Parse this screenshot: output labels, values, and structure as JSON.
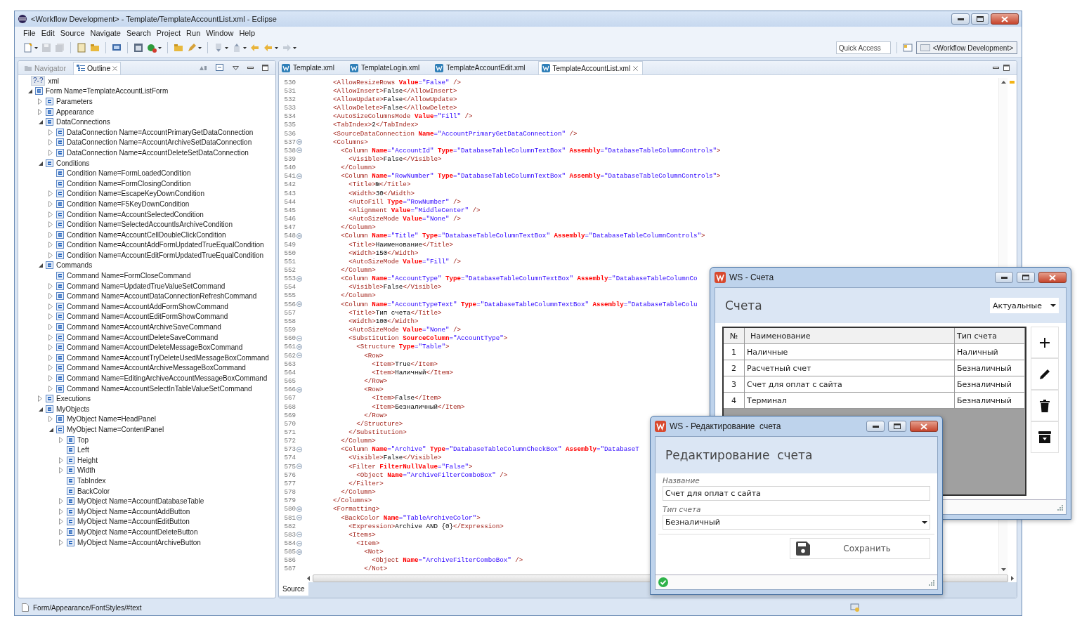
{
  "window": {
    "title": "<Workflow Development> - Template/TemplateAccountList.xml - Eclipse"
  },
  "menu": [
    "File",
    "Edit",
    "Source",
    "Navigate",
    "Search",
    "Project",
    "Run",
    "Window",
    "Help"
  ],
  "toolbar": {
    "quick_access": {
      "placeholder": "Quick Access"
    },
    "perspective": "<Workflow Development>"
  },
  "side_tabs": [
    {
      "label": "Navigator",
      "selected": false
    },
    {
      "label": "Outline",
      "selected": true
    }
  ],
  "outline": {
    "tree": [
      {
        "kind": "prolog",
        "badge": "?-?",
        "label": "xml"
      },
      {
        "kind": "element",
        "label": "Form Name=TemplateAccountListForm",
        "expanded": true,
        "children": [
          {
            "kind": "element",
            "label": "Parameters",
            "expanded": false
          },
          {
            "kind": "element",
            "label": "Appearance",
            "expanded": false
          },
          {
            "kind": "element",
            "label": "DataConnections",
            "expanded": true,
            "children": [
              {
                "kind": "element",
                "label": "DataConnection Name=AccountPrimaryGetDataConnection",
                "expanded": false
              },
              {
                "kind": "element",
                "label": "DataConnection Name=AccountArchiveSetDataConnection",
                "expanded": false
              },
              {
                "kind": "element",
                "label": "DataConnection Name=AccountDeleteSetDataConnection",
                "expanded": false
              }
            ]
          },
          {
            "kind": "element",
            "label": "Conditions",
            "expanded": true,
            "children": [
              {
                "kind": "element",
                "label": "Condition Name=FormLoadedCondition"
              },
              {
                "kind": "element",
                "label": "Condition Name=FormClosingCondition"
              },
              {
                "kind": "element",
                "label": "Condition Name=EscapeKeyDownCondition",
                "expanded": false
              },
              {
                "kind": "element",
                "label": "Condition Name=F5KeyDownCondition",
                "expanded": false
              },
              {
                "kind": "element",
                "label": "Condition Name=AccountSelectedCondition",
                "expanded": false
              },
              {
                "kind": "element",
                "label": "Condition Name=SelectedAccountIsArchiveCondition",
                "expanded": false
              },
              {
                "kind": "element",
                "label": "Condition Name=AccountCellDoubleClickCondition",
                "expanded": false
              },
              {
                "kind": "element",
                "label": "Condition Name=AccountAddFormUpdatedTrueEqualCondition",
                "expanded": false
              },
              {
                "kind": "element",
                "label": "Condition Name=AccountEditFormUpdatedTrueEqualCondition",
                "expanded": false
              }
            ]
          },
          {
            "kind": "element",
            "label": "Commands",
            "expanded": true,
            "children": [
              {
                "kind": "element",
                "label": "Command Name=FormCloseCommand"
              },
              {
                "kind": "element",
                "label": "Command Name=UpdatedTrueValueSetCommand",
                "expanded": false
              },
              {
                "kind": "element",
                "label": "Command Name=AccountDataConnectionRefreshCommand",
                "expanded": false
              },
              {
                "kind": "element",
                "label": "Command Name=AccountAddFormShowCommand",
                "expanded": false
              },
              {
                "kind": "element",
                "label": "Command Name=AccountEditFormShowCommand",
                "expanded": false
              },
              {
                "kind": "element",
                "label": "Command Name=AccountArchiveSaveCommand",
                "expanded": false
              },
              {
                "kind": "element",
                "label": "Command Name=AccountDeleteSaveCommand",
                "expanded": false
              },
              {
                "kind": "element",
                "label": "Command Name=AccountDeleteMessageBoxCommand",
                "expanded": false
              },
              {
                "kind": "element",
                "label": "Command Name=AccountTryDeleteUsedMessageBoxCommand",
                "expanded": false
              },
              {
                "kind": "element",
                "label": "Command Name=AccountArchiveMessageBoxCommand",
                "expanded": false
              },
              {
                "kind": "element",
                "label": "Command Name=EditingArchiveAccountMessageBoxCommand",
                "expanded": false
              },
              {
                "kind": "element",
                "label": "Command Name=AccountSelectInTableValueSetCommand",
                "expanded": false
              }
            ]
          },
          {
            "kind": "element",
            "label": "Executions",
            "expanded": false
          },
          {
            "kind": "element",
            "label": "MyObjects",
            "expanded": true,
            "children": [
              {
                "kind": "element",
                "label": "MyObject Name=HeadPanel",
                "expanded": false
              },
              {
                "kind": "element",
                "label": "MyObject Name=ContentPanel",
                "expanded": true,
                "children": [
                  {
                    "kind": "element",
                    "label": "Top",
                    "expanded": false
                  },
                  {
                    "kind": "element",
                    "label": "Left"
                  },
                  {
                    "kind": "element",
                    "label": "Height",
                    "expanded": false
                  },
                  {
                    "kind": "element",
                    "label": "Width",
                    "expanded": false
                  },
                  {
                    "kind": "element",
                    "label": "TabIndex"
                  },
                  {
                    "kind": "element",
                    "label": "BackColor"
                  },
                  {
                    "kind": "element",
                    "label": "MyObject Name=AccountDatabaseTable",
                    "expanded": false
                  },
                  {
                    "kind": "element",
                    "label": "MyObject Name=AccountAddButton",
                    "expanded": false
                  },
                  {
                    "kind": "element",
                    "label": "MyObject Name=AccountEditButton",
                    "expanded": false
                  },
                  {
                    "kind": "element",
                    "label": "MyObject Name=AccountDeleteButton",
                    "expanded": false
                  },
                  {
                    "kind": "element",
                    "label": "MyObject Name=AccountArchiveButton",
                    "expanded": false
                  }
                ]
              }
            ]
          }
        ]
      }
    ]
  },
  "editor": {
    "tabs": [
      {
        "label": "Template.xml",
        "selected": false
      },
      {
        "label": "TemplateLogin.xml",
        "selected": false
      },
      {
        "label": "TemplateAccountEdit.xml",
        "selected": false
      },
      {
        "label": "TemplateAccountList.xml",
        "selected": true
      }
    ],
    "lines": [
      {
        "number": "530",
        "foldable": false,
        "tokens": [
          {
            "kind": "tag",
            "text": "        <AllowResizeRows"
          },
          {
            "kind": "attr",
            "text": " Value"
          },
          {
            "kind": "value",
            "text": "=\"False\""
          },
          {
            "kind": "tag",
            "text": " />"
          }
        ]
      },
      {
        "number": "531",
        "foldable": false,
        "tokens": [
          {
            "kind": "tag",
            "text": "        <AllowInsert>"
          },
          {
            "kind": "text",
            "text": "False"
          },
          {
            "kind": "tag",
            "text": "</AllowInsert>"
          }
        ]
      },
      {
        "number": "532",
        "foldable": false,
        "tokens": [
          {
            "kind": "tag",
            "text": "        <AllowUpdate>"
          },
          {
            "kind": "text",
            "text": "False"
          },
          {
            "kind": "tag",
            "text": "</AllowUpdate>"
          }
        ]
      },
      {
        "number": "533",
        "foldable": false,
        "tokens": [
          {
            "kind": "tag",
            "text": "        <AllowDelete>"
          },
          {
            "kind": "text",
            "text": "False"
          },
          {
            "kind": "tag",
            "text": "</AllowDelete>"
          }
        ]
      },
      {
        "number": "534",
        "foldable": false,
        "tokens": [
          {
            "kind": "tag",
            "text": "        <AutoSizeColumnsMode"
          },
          {
            "kind": "attr",
            "text": " Value"
          },
          {
            "kind": "value",
            "text": "=\"Fill\""
          },
          {
            "kind": "tag",
            "text": " />"
          }
        ]
      },
      {
        "number": "535",
        "foldable": false,
        "tokens": [
          {
            "kind": "tag",
            "text": "        <TabIndex>"
          },
          {
            "kind": "text",
            "text": "2"
          },
          {
            "kind": "tag",
            "text": "</TabIndex>"
          }
        ]
      },
      {
        "number": "536",
        "foldable": false,
        "tokens": [
          {
            "kind": "tag",
            "text": "        <SourceDataConnection"
          },
          {
            "kind": "attr",
            "text": " Name"
          },
          {
            "kind": "value",
            "text": "=\"AccountPrimaryGetDataConnection\""
          },
          {
            "kind": "tag",
            "text": " />"
          }
        ]
      },
      {
        "number": "537",
        "foldable": true,
        "tokens": [
          {
            "kind": "tag",
            "text": "        <Columns>"
          }
        ]
      },
      {
        "number": "538",
        "foldable": true,
        "tokens": [
          {
            "kind": "tag",
            "text": "          <Column"
          },
          {
            "kind": "attr",
            "text": " Name"
          },
          {
            "kind": "value",
            "text": "=\"AccountId\""
          },
          {
            "kind": "attr",
            "text": " Type"
          },
          {
            "kind": "value",
            "text": "=\"DatabaseTableColumnTextBox\""
          },
          {
            "kind": "attr",
            "text": " Assembly"
          },
          {
            "kind": "value",
            "text": "=\"DatabaseTableColumnControls\""
          },
          {
            "kind": "tag",
            "text": ">"
          }
        ]
      },
      {
        "number": "539",
        "foldable": false,
        "tokens": [
          {
            "kind": "tag",
            "text": "            <Visible>"
          },
          {
            "kind": "text",
            "text": "False"
          },
          {
            "kind": "tag",
            "text": "</Visible>"
          }
        ]
      },
      {
        "number": "540",
        "foldable": false,
        "tokens": [
          {
            "kind": "tag",
            "text": "          </Column>"
          }
        ]
      },
      {
        "number": "541",
        "foldable": true,
        "tokens": [
          {
            "kind": "tag",
            "text": "          <Column"
          },
          {
            "kind": "attr",
            "text": " Name"
          },
          {
            "kind": "value",
            "text": "=\"RowNumber\""
          },
          {
            "kind": "attr",
            "text": " Type"
          },
          {
            "kind": "value",
            "text": "=\"DatabaseTableColumnTextBox\""
          },
          {
            "kind": "attr",
            "text": " Assembly"
          },
          {
            "kind": "value",
            "text": "=\"DatabaseTableColumnControls\""
          },
          {
            "kind": "tag",
            "text": ">"
          }
        ]
      },
      {
        "number": "542",
        "foldable": false,
        "tokens": [
          {
            "kind": "tag",
            "text": "            <Title>"
          },
          {
            "kind": "text",
            "text": "№"
          },
          {
            "kind": "tag",
            "text": "</Title>"
          }
        ]
      },
      {
        "number": "543",
        "foldable": false,
        "tokens": [
          {
            "kind": "tag",
            "text": "            <Width>"
          },
          {
            "kind": "text",
            "text": "30"
          },
          {
            "kind": "tag",
            "text": "</Width>"
          }
        ]
      },
      {
        "number": "544",
        "foldable": false,
        "tokens": [
          {
            "kind": "tag",
            "text": "            <AutoFill"
          },
          {
            "kind": "attr",
            "text": " Type"
          },
          {
            "kind": "value",
            "text": "=\"RowNumber\""
          },
          {
            "kind": "tag",
            "text": " />"
          }
        ]
      },
      {
        "number": "545",
        "foldable": false,
        "tokens": [
          {
            "kind": "tag",
            "text": "            <Alignment"
          },
          {
            "kind": "attr",
            "text": " Value"
          },
          {
            "kind": "value",
            "text": "=\"MiddleCenter\""
          },
          {
            "kind": "tag",
            "text": " />"
          }
        ]
      },
      {
        "number": "546",
        "foldable": false,
        "tokens": [
          {
            "kind": "tag",
            "text": "            <AutoSizeMode"
          },
          {
            "kind": "attr",
            "text": " Value"
          },
          {
            "kind": "value",
            "text": "=\"None\""
          },
          {
            "kind": "tag",
            "text": " />"
          }
        ]
      },
      {
        "number": "547",
        "foldable": false,
        "tokens": [
          {
            "kind": "tag",
            "text": "          </Column>"
          }
        ]
      },
      {
        "number": "548",
        "foldable": true,
        "tokens": [
          {
            "kind": "tag",
            "text": "          <Column"
          },
          {
            "kind": "attr",
            "text": " Name"
          },
          {
            "kind": "value",
            "text": "=\"Title\""
          },
          {
            "kind": "attr",
            "text": " Type"
          },
          {
            "kind": "value",
            "text": "=\"DatabaseTableColumnTextBox\""
          },
          {
            "kind": "attr",
            "text": " Assembly"
          },
          {
            "kind": "value",
            "text": "=\"DatabaseTableColumnControls\""
          },
          {
            "kind": "tag",
            "text": ">"
          }
        ]
      },
      {
        "number": "549",
        "foldable": false,
        "tokens": [
          {
            "kind": "tag",
            "text": "            <Title>"
          },
          {
            "kind": "text",
            "text": "Наименование"
          },
          {
            "kind": "tag",
            "text": "</Title>"
          }
        ]
      },
      {
        "number": "550",
        "foldable": false,
        "tokens": [
          {
            "kind": "tag",
            "text": "            <Width>"
          },
          {
            "kind": "text",
            "text": "150"
          },
          {
            "kind": "tag",
            "text": "</Width>"
          }
        ]
      },
      {
        "number": "551",
        "foldable": false,
        "tokens": [
          {
            "kind": "tag",
            "text": "            <AutoSizeMode"
          },
          {
            "kind": "attr",
            "text": " Value"
          },
          {
            "kind": "value",
            "text": "=\"Fill\""
          },
          {
            "kind": "tag",
            "text": " />"
          }
        ]
      },
      {
        "number": "552",
        "foldable": false,
        "tokens": [
          {
            "kind": "tag",
            "text": "          </Column>"
          }
        ]
      },
      {
        "number": "553",
        "foldable": true,
        "tokens": [
          {
            "kind": "tag",
            "text": "          <Column"
          },
          {
            "kind": "attr",
            "text": " Name"
          },
          {
            "kind": "value",
            "text": "=\"AccountType\""
          },
          {
            "kind": "attr",
            "text": " Type"
          },
          {
            "kind": "value",
            "text": "=\"DatabaseTableColumnTextBox\""
          },
          {
            "kind": "attr",
            "text": " Assembly"
          },
          {
            "kind": "value",
            "text": "=\"DatabaseTableColumnCo"
          }
        ]
      },
      {
        "number": "554",
        "foldable": false,
        "tokens": [
          {
            "kind": "tag",
            "text": "            <Visible>"
          },
          {
            "kind": "text",
            "text": "False"
          },
          {
            "kind": "tag",
            "text": "</Visible>"
          }
        ]
      },
      {
        "number": "555",
        "foldable": false,
        "tokens": [
          {
            "kind": "tag",
            "text": "          </Column>"
          }
        ]
      },
      {
        "number": "556",
        "foldable": true,
        "tokens": [
          {
            "kind": "tag",
            "text": "          <Column"
          },
          {
            "kind": "attr",
            "text": " Name"
          },
          {
            "kind": "value",
            "text": "=\"AccountTypeText\""
          },
          {
            "kind": "attr",
            "text": " Type"
          },
          {
            "kind": "value",
            "text": "=\"DatabaseTableColumnTextBox\""
          },
          {
            "kind": "attr",
            "text": " Assembly"
          },
          {
            "kind": "value",
            "text": "=\"DatabaseTableColu"
          }
        ]
      },
      {
        "number": "557",
        "foldable": false,
        "tokens": [
          {
            "kind": "tag",
            "text": "            <Title>"
          },
          {
            "kind": "text",
            "text": "Тип счета"
          },
          {
            "kind": "tag",
            "text": "</Title>"
          }
        ]
      },
      {
        "number": "558",
        "foldable": false,
        "tokens": [
          {
            "kind": "tag",
            "text": "            <Width>"
          },
          {
            "kind": "text",
            "text": "100"
          },
          {
            "kind": "tag",
            "text": "</Width>"
          }
        ]
      },
      {
        "number": "559",
        "foldable": false,
        "tokens": [
          {
            "kind": "tag",
            "text": "            <AutoSizeMode"
          },
          {
            "kind": "attr",
            "text": " Value"
          },
          {
            "kind": "value",
            "text": "=\"None\""
          },
          {
            "kind": "tag",
            "text": " />"
          }
        ]
      },
      {
        "number": "560",
        "foldable": true,
        "tokens": [
          {
            "kind": "tag",
            "text": "            <Substitution"
          },
          {
            "kind": "attr",
            "text": " SourceColumn"
          },
          {
            "kind": "value",
            "text": "=\"AccountType\""
          },
          {
            "kind": "tag",
            "text": ">"
          }
        ]
      },
      {
        "number": "561",
        "foldable": true,
        "tokens": [
          {
            "kind": "tag",
            "text": "              <Structure"
          },
          {
            "kind": "attr",
            "text": " Type"
          },
          {
            "kind": "value",
            "text": "=\"Table\""
          },
          {
            "kind": "tag",
            "text": ">"
          }
        ]
      },
      {
        "number": "562",
        "foldable": true,
        "tokens": [
          {
            "kind": "tag",
            "text": "                <Row>"
          }
        ]
      },
      {
        "number": "563",
        "foldable": false,
        "tokens": [
          {
            "kind": "tag",
            "text": "                  <Item>"
          },
          {
            "kind": "text",
            "text": "True"
          },
          {
            "kind": "tag",
            "text": "</Item>"
          }
        ]
      },
      {
        "number": "564",
        "foldable": false,
        "tokens": [
          {
            "kind": "tag",
            "text": "                  <Item>"
          },
          {
            "kind": "text",
            "text": "Наличный"
          },
          {
            "kind": "tag",
            "text": "</Item>"
          }
        ]
      },
      {
        "number": "565",
        "foldable": false,
        "tokens": [
          {
            "kind": "tag",
            "text": "                </Row>"
          }
        ]
      },
      {
        "number": "566",
        "foldable": true,
        "tokens": [
          {
            "kind": "tag",
            "text": "                <Row>"
          }
        ]
      },
      {
        "number": "567",
        "foldable": false,
        "tokens": [
          {
            "kind": "tag",
            "text": "                  <Item>"
          },
          {
            "kind": "text",
            "text": "False"
          },
          {
            "kind": "tag",
            "text": "</Item>"
          }
        ]
      },
      {
        "number": "568",
        "foldable": false,
        "tokens": [
          {
            "kind": "tag",
            "text": "                  <Item>"
          },
          {
            "kind": "text",
            "text": "Безналичный"
          },
          {
            "kind": "tag",
            "text": "</Item>"
          }
        ]
      },
      {
        "number": "569",
        "foldable": false,
        "tokens": [
          {
            "kind": "tag",
            "text": "                </Row>"
          }
        ]
      },
      {
        "number": "570",
        "foldable": false,
        "tokens": [
          {
            "kind": "tag",
            "text": "              </Structure>"
          }
        ]
      },
      {
        "number": "571",
        "foldable": false,
        "tokens": [
          {
            "kind": "tag",
            "text": "            </Substitution>"
          }
        ]
      },
      {
        "number": "572",
        "foldable": false,
        "tokens": [
          {
            "kind": "tag",
            "text": "          </Column>"
          }
        ]
      },
      {
        "number": "573",
        "foldable": true,
        "tokens": [
          {
            "kind": "tag",
            "text": "          <Column"
          },
          {
            "kind": "attr",
            "text": " Name"
          },
          {
            "kind": "value",
            "text": "=\"Archive\""
          },
          {
            "kind": "attr",
            "text": " Type"
          },
          {
            "kind": "value",
            "text": "=\"DatabaseTableColumnCheckBox\""
          },
          {
            "kind": "attr",
            "text": " Assembly"
          },
          {
            "kind": "value",
            "text": "=\"DatabaseT"
          }
        ]
      },
      {
        "number": "574",
        "foldable": false,
        "tokens": [
          {
            "kind": "tag",
            "text": "            <Visible>"
          },
          {
            "kind": "text",
            "text": "False"
          },
          {
            "kind": "tag",
            "text": "</Visible>"
          }
        ]
      },
      {
        "number": "575",
        "foldable": true,
        "tokens": [
          {
            "kind": "tag",
            "text": "            <Filter"
          },
          {
            "kind": "attr",
            "text": " FilterNullValue"
          },
          {
            "kind": "value",
            "text": "=\"False\""
          },
          {
            "kind": "tag",
            "text": ">"
          }
        ]
      },
      {
        "number": "576",
        "foldable": false,
        "tokens": [
          {
            "kind": "tag",
            "text": "              <Object"
          },
          {
            "kind": "attr",
            "text": " Name"
          },
          {
            "kind": "value",
            "text": "=\"ArchiveFilterComboBox\""
          },
          {
            "kind": "tag",
            "text": " />"
          }
        ]
      },
      {
        "number": "577",
        "foldable": false,
        "tokens": [
          {
            "kind": "tag",
            "text": "            </Filter>"
          }
        ]
      },
      {
        "number": "578",
        "foldable": false,
        "tokens": [
          {
            "kind": "tag",
            "text": "          </Column>"
          }
        ]
      },
      {
        "number": "579",
        "foldable": false,
        "tokens": [
          {
            "kind": "tag",
            "text": "        </Columns>"
          }
        ]
      },
      {
        "number": "580",
        "foldable": true,
        "tokens": [
          {
            "kind": "tag",
            "text": "        <Formatting>"
          }
        ]
      },
      {
        "number": "581",
        "foldable": true,
        "tokens": [
          {
            "kind": "tag",
            "text": "          <BackColor"
          },
          {
            "kind": "attr",
            "text": " Name"
          },
          {
            "kind": "value",
            "text": "=\"TableArchiveColor\""
          },
          {
            "kind": "tag",
            "text": ">"
          }
        ]
      },
      {
        "number": "582",
        "foldable": false,
        "tokens": [
          {
            "kind": "tag",
            "text": "            <Expression>"
          },
          {
            "kind": "text",
            "text": "Archive AND {0}"
          },
          {
            "kind": "tag",
            "text": "</Expression>"
          }
        ]
      },
      {
        "number": "583",
        "foldable": true,
        "tokens": [
          {
            "kind": "tag",
            "text": "            <Items>"
          }
        ]
      },
      {
        "number": "584",
        "foldable": true,
        "tokens": [
          {
            "kind": "tag",
            "text": "              <Item>"
          }
        ]
      },
      {
        "number": "585",
        "foldable": true,
        "tokens": [
          {
            "kind": "tag",
            "text": "                <Not>"
          }
        ]
      },
      {
        "number": "586",
        "foldable": false,
        "tokens": [
          {
            "kind": "tag",
            "text": "                  <Object"
          },
          {
            "kind": "attr",
            "text": " Name"
          },
          {
            "kind": "value",
            "text": "=\"ArchiveFilterComboBox\""
          },
          {
            "kind": "tag",
            "text": " />"
          }
        ]
      },
      {
        "number": "587",
        "foldable": false,
        "tokens": [
          {
            "kind": "tag",
            "text": "                </Not>"
          }
        ]
      }
    ],
    "bottom_tabs": [
      {
        "label": "Source",
        "selected": true
      }
    ]
  },
  "status_bar": {
    "path": "Form/Appearance/FontStyles/#text"
  },
  "accounts_window": {
    "title": "WS - Счета",
    "heading": "Счета",
    "filter": "Актуальные",
    "columns": [
      "№",
      "Наименование",
      "Тип счета"
    ],
    "rows": [
      [
        "1",
        "Наличные",
        "Наличный"
      ],
      [
        "2",
        "Расчетный счет",
        "Безналичный"
      ],
      [
        "3",
        "Счет для оплат с сайта",
        "Безналичный"
      ],
      [
        "4",
        "Терминал",
        "Безналичный"
      ]
    ]
  },
  "edit_dialog": {
    "title": "WS - Редактирование  счета",
    "heading": "Редактирование  счета",
    "fields": [
      {
        "kind": "text",
        "label": "Название",
        "value": "Счет для оплат с сайта"
      },
      {
        "kind": "select",
        "label": "Тип счета",
        "value": "Безналичный"
      }
    ],
    "save_button": "Сохранить"
  }
}
